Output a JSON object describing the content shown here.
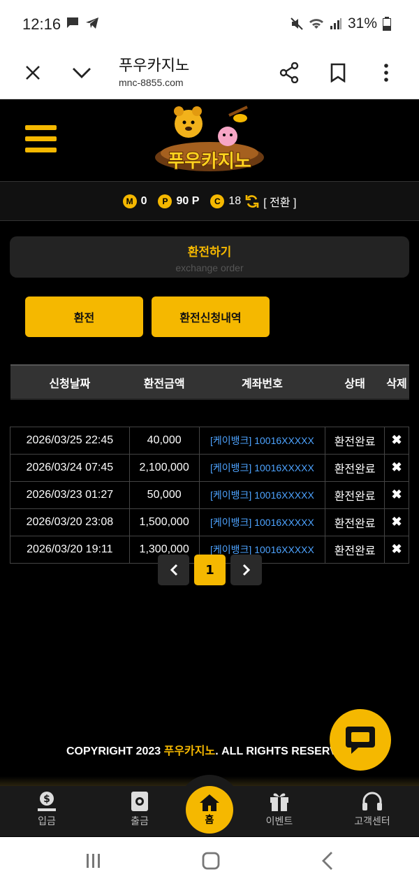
{
  "status_bar": {
    "time": "12:16",
    "battery": "31%"
  },
  "browser": {
    "title": "푸우카지노",
    "url": "mnc-8855.com",
    "icons": [
      "close-icon",
      "chevron-down-icon",
      "share-icon",
      "bookmark-icon",
      "more-vert-icon"
    ]
  },
  "site": {
    "logo_text": "푸우카지노",
    "points": {
      "m_badge": "M",
      "m_value": "0",
      "p_badge": "P",
      "p_value": "90 P",
      "c_badge": "C",
      "c_value": "18",
      "convert_label": "[ 전환 ]"
    }
  },
  "page": {
    "title": "환전하기",
    "subtitle": "exchange order",
    "tabs": [
      {
        "label": "환전"
      },
      {
        "label": "환전신청내역"
      }
    ]
  },
  "table": {
    "headers": [
      "신청날짜",
      "환전금액",
      "계좌번호",
      "상태",
      "삭제"
    ],
    "rows": [
      {
        "date": "2026/03/25 22:45",
        "amount": "40,000",
        "account": "[케이뱅크] 10016XXXXX",
        "status": "환전완료",
        "delete": "✖"
      },
      {
        "date": "2026/03/24 07:45",
        "amount": "2,100,000",
        "account": "[케이뱅크] 10016XXXXX",
        "status": "환전완료",
        "delete": "✖"
      },
      {
        "date": "2026/03/23 01:27",
        "amount": "50,000",
        "account": "[케이뱅크] 10016XXXXX",
        "status": "환전완료",
        "delete": "✖"
      },
      {
        "date": "2026/03/20 23:08",
        "amount": "1,500,000",
        "account": "[케이뱅크] 10016XXXXX",
        "status": "환전완료",
        "delete": "✖"
      },
      {
        "date": "2026/03/20 19:11",
        "amount": "1,300,000",
        "account": "[케이뱅크] 10016XXXXX",
        "status": "환전완료",
        "delete": "✖"
      }
    ]
  },
  "pagination": {
    "prev": "‹",
    "current": "1",
    "next": "›"
  },
  "footer": {
    "copyright_prefix": "COPYRIGHT 2023 ",
    "copyright_brand": "푸우카지노",
    "copyright_suffix": ". ALL RIGHTS RESERVED"
  },
  "bottom_nav": [
    {
      "label": "입금",
      "icon": "deposit-icon"
    },
    {
      "label": "출금",
      "icon": "withdraw-icon"
    },
    {
      "label": "홈",
      "icon": "home-icon"
    },
    {
      "label": "이벤트",
      "icon": "gift-icon"
    },
    {
      "label": "고객센터",
      "icon": "headset-icon"
    }
  ],
  "colors": {
    "accent": "#f5b800",
    "link": "#4da3ff",
    "bg": "#000000"
  }
}
